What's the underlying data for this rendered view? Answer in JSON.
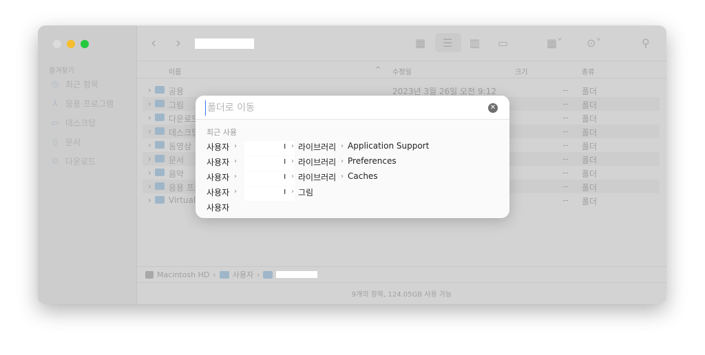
{
  "window": {
    "traffic_lights": {
      "close": "#dcdcdc",
      "minimize": "#f6bd2f",
      "zoom": "#27c840"
    }
  },
  "sidebar": {
    "section": "즐겨찾기",
    "items": [
      {
        "label": "최근 항목",
        "icon": "clock-icon"
      },
      {
        "label": "응용 프로그램",
        "icon": "apps-icon"
      },
      {
        "label": "데스크탑",
        "icon": "desktop-icon"
      },
      {
        "label": "문서",
        "icon": "document-icon"
      },
      {
        "label": "다운로드",
        "icon": "download-icon"
      }
    ]
  },
  "columns": {
    "name": "이름",
    "modified": "수정일",
    "size": "크기",
    "kind": "종류"
  },
  "files": [
    {
      "name": "공용",
      "modified": "2023년 3월 26일 오전 9:12",
      "size": "--",
      "kind": "폴더"
    },
    {
      "name": "그림",
      "modified": "",
      "size": "--",
      "kind": "폴더"
    },
    {
      "name": "다운로드",
      "modified": "",
      "size": "--",
      "kind": "폴더"
    },
    {
      "name": "데스크탑",
      "modified": "",
      "size": "--",
      "kind": "폴더"
    },
    {
      "name": "동영상",
      "modified": "",
      "size": "--",
      "kind": "폴더"
    },
    {
      "name": "문서",
      "modified": "",
      "size": "--",
      "kind": "폴더"
    },
    {
      "name": "음악",
      "modified": "",
      "size": "--",
      "kind": "폴더"
    },
    {
      "name": "응용 프로그램",
      "modified": "",
      "size": "--",
      "kind": "폴더"
    },
    {
      "name": "VirtualBox VMs",
      "modified": "",
      "size": "--",
      "kind": "폴더"
    }
  ],
  "pathbar": {
    "disk": "Macintosh HD",
    "users": "사용자"
  },
  "status": "9개의 항목, 124.05GB 사용 가능",
  "dialog": {
    "placeholder": "폴더로 이동",
    "recent_label": "최근 사용",
    "rows": [
      {
        "a": "사용자",
        "b": "라이브러리",
        "c": "Application Support"
      },
      {
        "a": "사용자",
        "b": "라이브러리",
        "c": "Preferences"
      },
      {
        "a": "사용자",
        "b": "라이브러리",
        "c": "Caches"
      },
      {
        "a": "사용자",
        "b": "그림",
        "c": ""
      },
      {
        "a": "사용자",
        "b": "",
        "c": ""
      }
    ]
  }
}
